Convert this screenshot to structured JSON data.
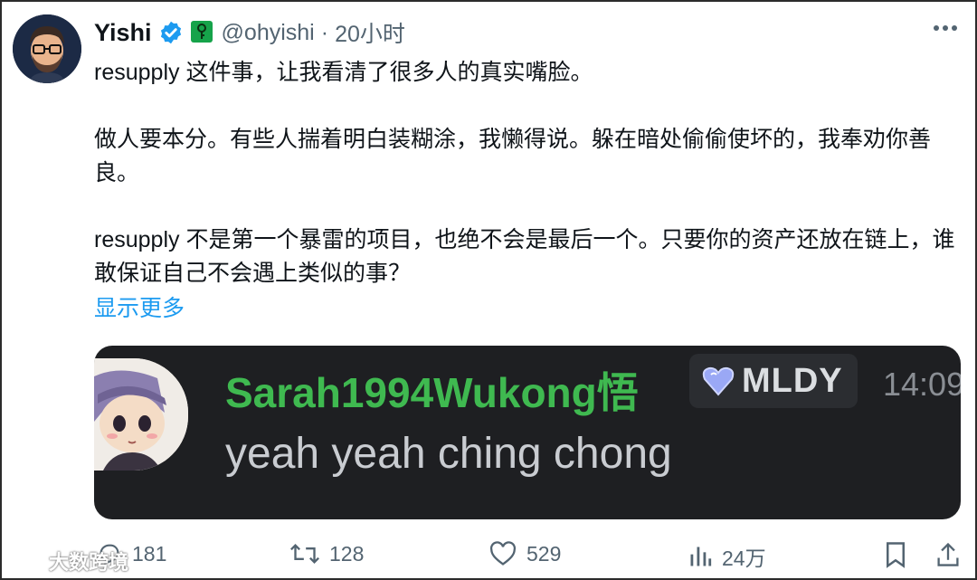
{
  "tweet": {
    "author_name": "Yishi",
    "handle": "@ohyishi",
    "separator": "·",
    "time": "20小时",
    "paragraphs": [
      "resupply 这件事，让我看清了很多人的真实嘴脸。",
      "做人要本分。有些人揣着明白装糊涂，我懒得说。躲在暗处偷偷使坏的，我奉劝你善良。",
      "resupply 不是第一个暴雷的项目，也绝不会是最后一个。只要你的资产还放在链上，谁敢保证自己不会遇上类似的事？"
    ],
    "show_more": "显示更多"
  },
  "embed": {
    "username": "Sarah1994Wukong悟",
    "tag": "MLDY",
    "time": "14:09",
    "message": "yeah yeah ching chong"
  },
  "actions": {
    "replies": "181",
    "reposts": "128",
    "likes": "529",
    "views": "24万"
  },
  "watermark": "大数跨境",
  "colors": {
    "link": "#1d9bf0",
    "verified": "#1d9bf0",
    "username_green": "#3fb950",
    "card_bg": "#1e1f22",
    "muted": "#536471"
  },
  "icons": [
    "verified-badge-icon",
    "key-badge-icon",
    "more-icon",
    "heart-gem-icon",
    "reply-icon",
    "repost-icon",
    "like-icon",
    "views-icon",
    "bookmark-icon",
    "share-icon"
  ]
}
